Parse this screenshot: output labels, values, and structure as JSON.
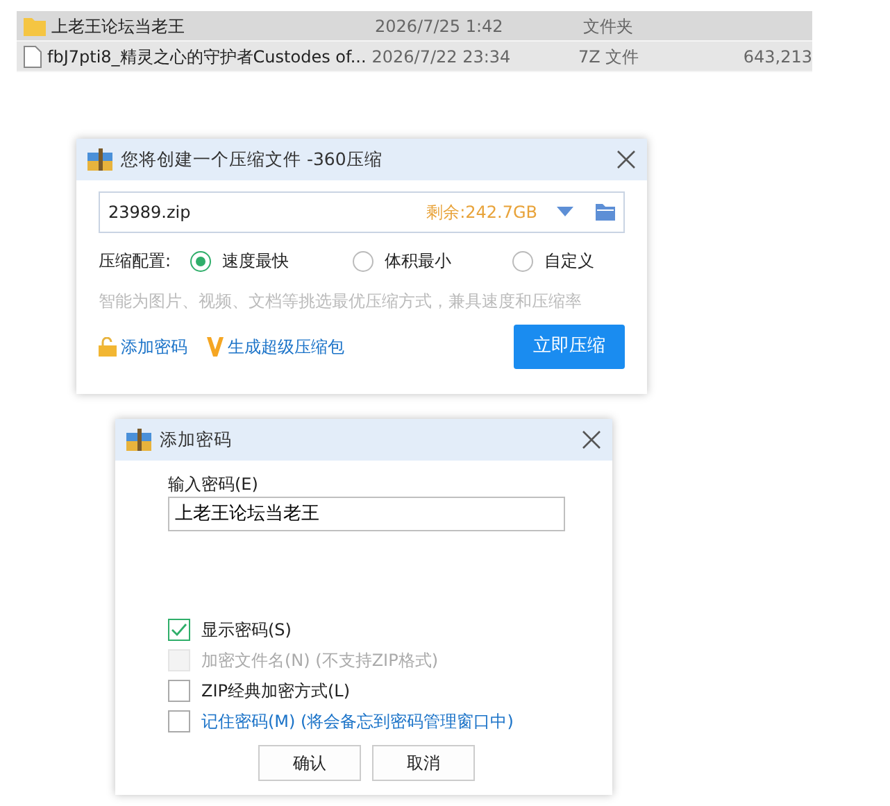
{
  "file_list": [
    {
      "kind": "folder",
      "name": "上老王论坛当老王",
      "date": "2026/7/25 1:42",
      "type": "文件夹",
      "selected": true
    },
    {
      "kind": "file",
      "name": "fbJ7pti8_精灵之心的守护者Custodes of...",
      "date": "2026/7/22 23:34",
      "type": "7Z 文件",
      "size": "643,213",
      "selected": false
    }
  ],
  "compress_dialog": {
    "title": "您将创建一个压缩文件 -360压缩",
    "filename": "23989.zip",
    "free_space": "剩余:242.7GB",
    "config_label": "压缩配置:",
    "options": [
      {
        "label": "速度最快",
        "selected": true
      },
      {
        "label": "体积最小",
        "selected": false
      },
      {
        "label": "自定义",
        "selected": false
      }
    ],
    "hint": "智能为图片、视频、文档等挑选最优压缩方式，兼具速度和压缩率",
    "links": [
      {
        "kind": "lock",
        "label": "添加密码"
      },
      {
        "kind": "v",
        "label": "生成超级压缩包"
      }
    ],
    "button": "立即压缩"
  },
  "password_dialog": {
    "title": "添加密码",
    "field_label": "输入密码(E)",
    "password": "上老王论坛当老王",
    "checks": [
      {
        "label": "显示密码(S)",
        "checked": true,
        "disabled": false,
        "kind": "option"
      },
      {
        "label": "加密文件名(N) (不支持ZIP格式)",
        "checked": false,
        "disabled": true,
        "kind": "option"
      },
      {
        "label": "ZIP经典加密方式(L)",
        "checked": false,
        "disabled": false,
        "kind": "option"
      },
      {
        "label": "记住密码(M) (将会备忘到密码管理窗口中)",
        "checked": false,
        "disabled": false,
        "kind": "link"
      }
    ],
    "buttons": [
      "确认",
      "取消"
    ]
  }
}
